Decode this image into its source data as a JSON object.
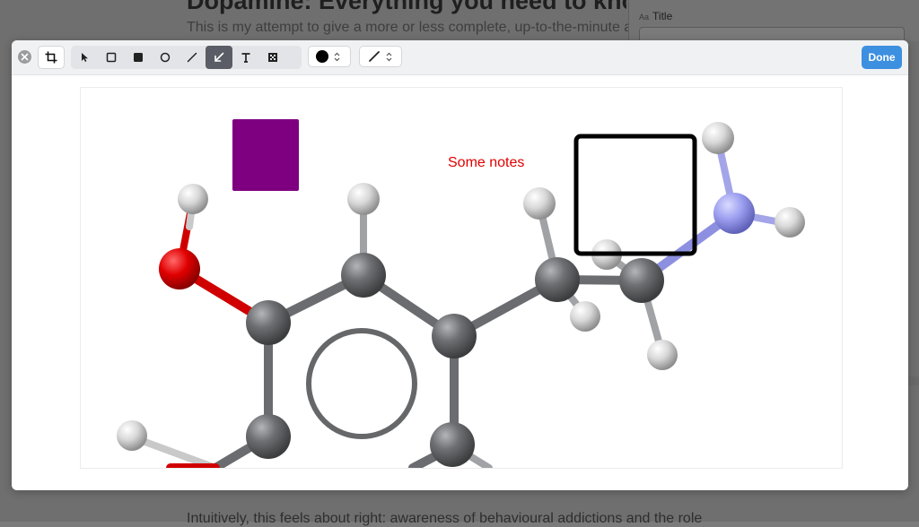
{
  "background": {
    "title": "Dopamine: Everything you need to know",
    "subtitle": "This is my attempt to give a more or less complete, up-to-the-minute account",
    "footer": "Intuitively, this feels about right: awareness of behavioural addictions and the role",
    "side_label_prefix": "Aa",
    "side_label": "Title"
  },
  "toolbar": {
    "tools": [
      "select-tool",
      "rectangle-tool",
      "filled-rectangle-tool",
      "ellipse-tool",
      "line-tool",
      "arrow-tool",
      "text-tool",
      "pixelate-tool"
    ],
    "active_tool": "arrow-tool",
    "color": "#000000",
    "done_label": "Done",
    "done_color": "#3d8fe0"
  },
  "annotations": {
    "note_text": "Some notes",
    "note_color": "#e00000",
    "square_fill": "#7e0080",
    "rect_stroke": "#000000"
  }
}
